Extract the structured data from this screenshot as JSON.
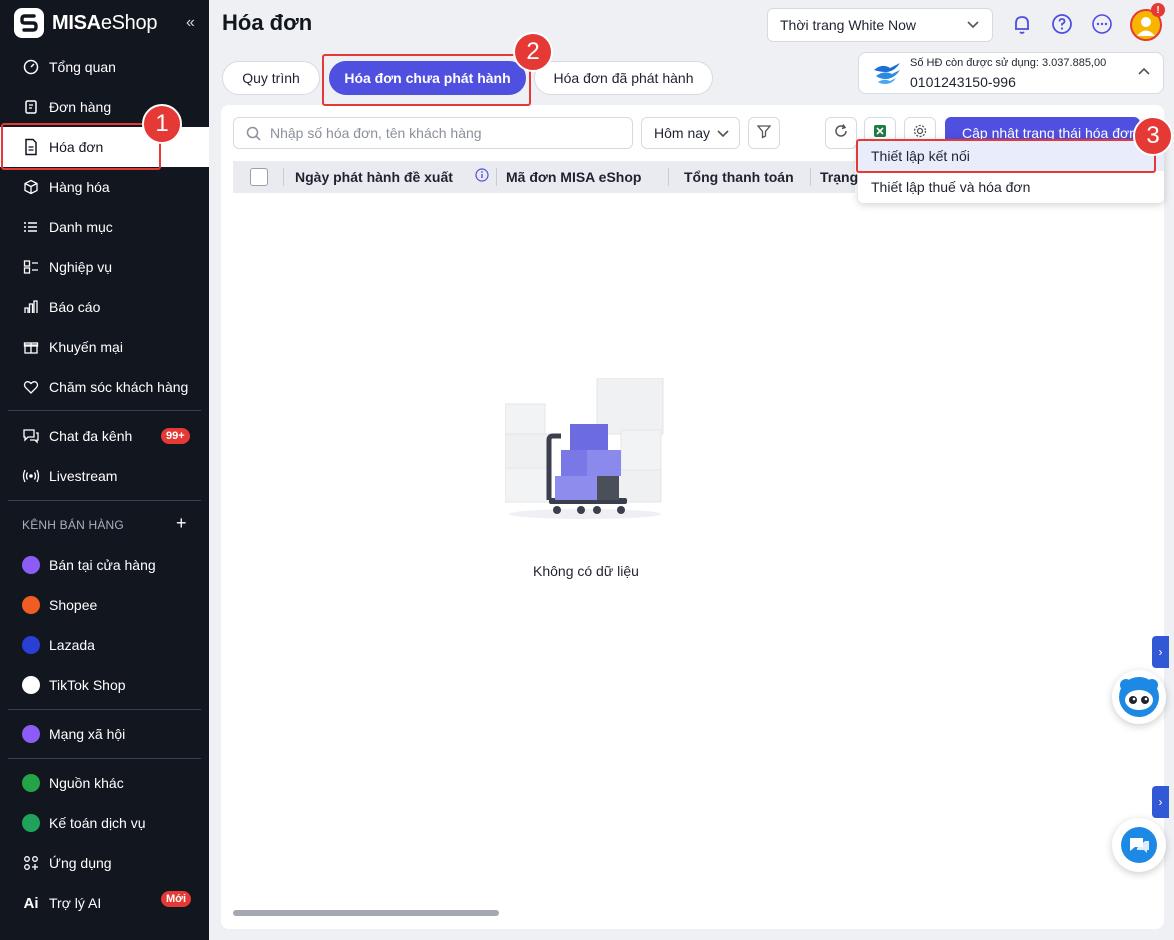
{
  "brand": {
    "name_bold": "MISA",
    "name_thin": "eShop",
    "collapse_icon": "«"
  },
  "sidebar": {
    "items": [
      {
        "label": "Tổng quan",
        "icon": "gauge-icon"
      },
      {
        "label": "Đơn hàng",
        "icon": "order-icon"
      },
      {
        "label": "Hóa đơn",
        "icon": "invoice-icon",
        "active": true
      },
      {
        "label": "Hàng hóa",
        "icon": "box-icon"
      },
      {
        "label": "Danh mục",
        "icon": "list-icon"
      },
      {
        "label": "Nghiệp vụ",
        "icon": "task-icon"
      },
      {
        "label": "Báo cáo",
        "icon": "chart-icon"
      },
      {
        "label": "Khuyến mại",
        "icon": "gift-icon"
      },
      {
        "label": "Chăm sóc khách hàng",
        "icon": "heart-icon"
      }
    ],
    "chat": {
      "label": "Chat đa kênh",
      "badge": "99+"
    },
    "livestream": {
      "label": "Livestream"
    },
    "channels_title": "KÊNH BÁN HÀNG",
    "channels_add": "+",
    "channels": [
      {
        "label": "Bán tại cửa hàng",
        "color": "#8b5cf6"
      },
      {
        "label": "Shopee",
        "color": "#f05d23"
      },
      {
        "label": "Lazada",
        "color": "#2a3fd6"
      },
      {
        "label": "TikTok Shop",
        "color": "#ffffff"
      }
    ],
    "social": {
      "label": "Mạng xã hội",
      "color": "#8b5cf6"
    },
    "other": {
      "label": "Nguồn khác",
      "color": "#22a447"
    },
    "accounting": {
      "label": "Kế toán dịch vụ",
      "color": "#1fa35b"
    },
    "apps": {
      "label": "Ứng dụng"
    },
    "ai": {
      "label": "Trợ lý AI",
      "icon_text": "Ai",
      "badge": "Mới"
    }
  },
  "header": {
    "title": "Hóa đơn",
    "store": "Thời trang White Now",
    "avatar_badge": "!"
  },
  "tabs": [
    {
      "label": "Quy trình"
    },
    {
      "label": "Hóa đơn chưa phát hành",
      "active": true
    },
    {
      "label": "Hóa đơn đã phát hành"
    }
  ],
  "invoice_card": {
    "line1": "Số HĐ còn được sử dụng: 3.037.885,00",
    "line2": "0101243150-996"
  },
  "toolbar": {
    "search_placeholder": "Nhập số hóa đơn, tên khách hàng",
    "date_filter": "Hôm nay",
    "update_button": "Cập nhật trạng thái hóa đơn"
  },
  "table": {
    "columns": [
      "Ngày phát hành đề xuất",
      "Mã đơn MISA eShop",
      "Tổng thanh toán",
      "Trạng"
    ],
    "empty_text": "Không có dữ liệu"
  },
  "dropdown": {
    "items": [
      "Thiết lập kết nối",
      "Thiết lập thuế và hóa đơn"
    ]
  },
  "steps": [
    "1",
    "2",
    "3"
  ],
  "colors": {
    "primary": "#4f4fe0",
    "sidebar": "#12161f",
    "highlight": "#e53935"
  }
}
